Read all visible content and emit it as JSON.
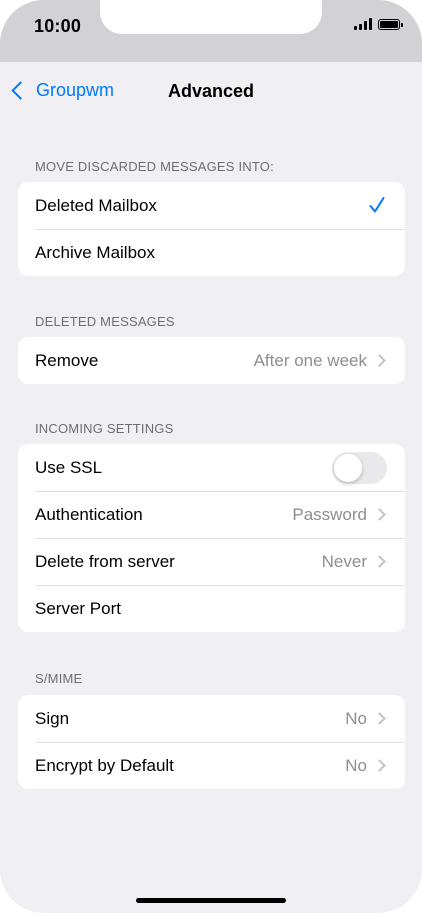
{
  "status_bar": {
    "time": "10:00"
  },
  "nav": {
    "back_label": "Groupwm",
    "title": "Advanced"
  },
  "sections": {
    "move_discarded": {
      "header": "MOVE DISCARDED MESSAGES INTO:",
      "rows": [
        {
          "label": "Deleted Mailbox",
          "selected": true
        },
        {
          "label": "Archive Mailbox",
          "selected": false
        }
      ]
    },
    "deleted_messages": {
      "header": "DELETED MESSAGES",
      "rows": [
        {
          "label": "Remove",
          "value": "After one week"
        }
      ]
    },
    "incoming_settings": {
      "header": "INCOMING SETTINGS",
      "rows": [
        {
          "label": "Use SSL",
          "toggle_on": false
        },
        {
          "label": "Authentication",
          "value": "Password"
        },
        {
          "label": "Delete from server",
          "value": "Never"
        },
        {
          "label": "Server Port",
          "value": ""
        }
      ]
    },
    "smime": {
      "header": "S/MIME",
      "rows": [
        {
          "label": "Sign",
          "value": "No"
        },
        {
          "label": "Encrypt by Default",
          "value": "No"
        }
      ]
    }
  },
  "colors": {
    "accent": "#007aff",
    "background": "#efeff4",
    "secondary_text": "#8e8e93",
    "status_bar": "#d1d1d6"
  }
}
